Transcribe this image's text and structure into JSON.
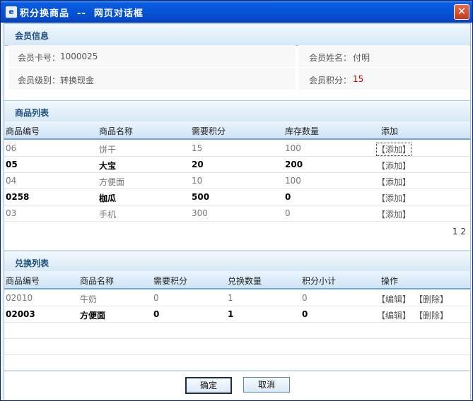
{
  "window": {
    "title": "积分换商品  --  网页对话框"
  },
  "member": {
    "section_title": "会员信息",
    "card_label": "会员卡号：",
    "card_value": "1000025",
    "name_label": "会员姓名：",
    "name_value": "付明",
    "level_label": "会员级别：",
    "level_value": "转换现金",
    "points_label": "会员积分：",
    "points_value": "15"
  },
  "products": {
    "section_title": "商品列表",
    "headers": [
      "商品编号",
      "商品名称",
      "需要积分",
      "库存数量",
      "添加"
    ],
    "rows": [
      {
        "code": "06",
        "name": "饼干",
        "points": "15",
        "stock": "100",
        "action": "【添加】"
      },
      {
        "code": "05",
        "name": "大宝",
        "points": "20",
        "stock": "200",
        "action": "【添加】"
      },
      {
        "code": "04",
        "name": "方便面",
        "points": "10",
        "stock": "100",
        "action": "【添加】"
      },
      {
        "code": "0258",
        "name": "枷瓜",
        "points": "500",
        "stock": "0",
        "action": "【添加】"
      },
      {
        "code": "03",
        "name": "手机",
        "points": "300",
        "stock": "0",
        "action": "【添加】"
      }
    ],
    "pages": [
      "1",
      "2"
    ]
  },
  "exchange": {
    "section_title": "兑换列表",
    "headers": [
      "商品编号",
      "商品名称",
      "需要积分",
      "兑换数量",
      "积分小计",
      "操作"
    ],
    "rows": [
      {
        "code": "02010",
        "name": "牛奶",
        "points": "0",
        "qty": "1",
        "subtotal": "0",
        "edit": "【编辑】",
        "delete": "【删除】"
      },
      {
        "code": "02003",
        "name": "方便面",
        "points": "0",
        "qty": "1",
        "subtotal": "0",
        "edit": "【编辑】",
        "delete": "【删除】"
      }
    ]
  },
  "buttons": {
    "ok": "确定",
    "cancel": "取消"
  },
  "colors": {
    "title_bar": "#0554d8",
    "section_text": "#1d4f7a",
    "points_value": "#d00000"
  }
}
